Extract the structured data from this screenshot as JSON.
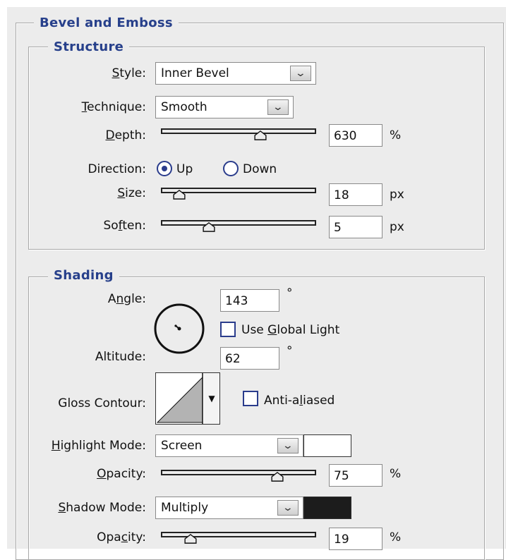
{
  "panel_title": "Bevel and Emboss",
  "structure": {
    "title": "Structure",
    "style": {
      "pre": "",
      "u": "S",
      "post": "tyle:",
      "value": "Inner Bevel"
    },
    "technique": {
      "pre": "",
      "u": "T",
      "post": "echnique:",
      "value": "Smooth"
    },
    "depth": {
      "pre": "",
      "u": "D",
      "post": "epth:",
      "value": "630",
      "unit": "%",
      "level": 0.64
    },
    "direction": {
      "label": "Direction:",
      "up": "Up",
      "down": "Down",
      "selected": "Up"
    },
    "size": {
      "pre": "",
      "u": "S",
      "post": "ize:",
      "value": "18",
      "unit": "px",
      "level": 0.12
    },
    "soften": {
      "pre": "So",
      "u": "f",
      "post": "ten:",
      "value": "5",
      "unit": "px",
      "level": 0.31
    }
  },
  "shading": {
    "title": "Shading",
    "angle": {
      "pre": "A",
      "u": "n",
      "post": "gle:",
      "value": "143",
      "unit": "°"
    },
    "use_global_light": {
      "pre": "Use ",
      "u": "G",
      "post": "lobal Light",
      "checked": false
    },
    "altitude": {
      "label": "Altitude:",
      "value": "62",
      "unit": "°"
    },
    "gloss_contour": {
      "label": "Gloss Contour:"
    },
    "anti_aliased": {
      "pre": "Anti-a",
      "u": "l",
      "post": "iased",
      "checked": false
    },
    "highlight_mode": {
      "pre": "",
      "u": "H",
      "post": "ighlight Mode:",
      "value": "Screen",
      "color": "#ffffff"
    },
    "highlight_opacity": {
      "pre": "",
      "u": "O",
      "post": "pacity:",
      "value": "75",
      "unit": "%",
      "level": 0.75
    },
    "shadow_mode": {
      "pre": "",
      "u": "S",
      "post": "hadow Mode:",
      "value": "Multiply",
      "color": "#1c1c1c"
    },
    "shadow_opacity": {
      "pre": "Opa",
      "u": "c",
      "post": "ity:",
      "value": "19",
      "unit": "%",
      "level": 0.19
    }
  },
  "icons": {
    "dropdown": "chevron-down-icon",
    "thumb": "slider-thumb-icon"
  }
}
